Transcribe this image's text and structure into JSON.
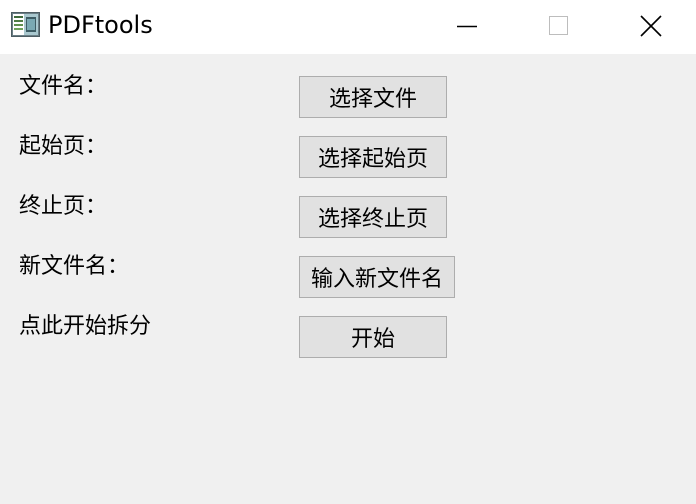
{
  "window": {
    "title": "PDFtools",
    "icon": "pdftools-app-icon",
    "controls": {
      "minimize": "minimize-icon",
      "maximize": "maximize-icon",
      "close": "close-icon"
    }
  },
  "form": {
    "rows": [
      {
        "label": "文件名：",
        "button": "选择文件"
      },
      {
        "label": "起始页：",
        "button": "选择起始页"
      },
      {
        "label": "终止页：",
        "button": "选择终止页"
      },
      {
        "label": "新文件名：",
        "button": "输入新文件名"
      },
      {
        "label": "点此开始拆分",
        "button": "开始"
      }
    ]
  },
  "colors": {
    "background": "#f0f0f0",
    "titlebar": "#ffffff",
    "button_face": "#e1e1e1",
    "button_border": "#adadad"
  }
}
